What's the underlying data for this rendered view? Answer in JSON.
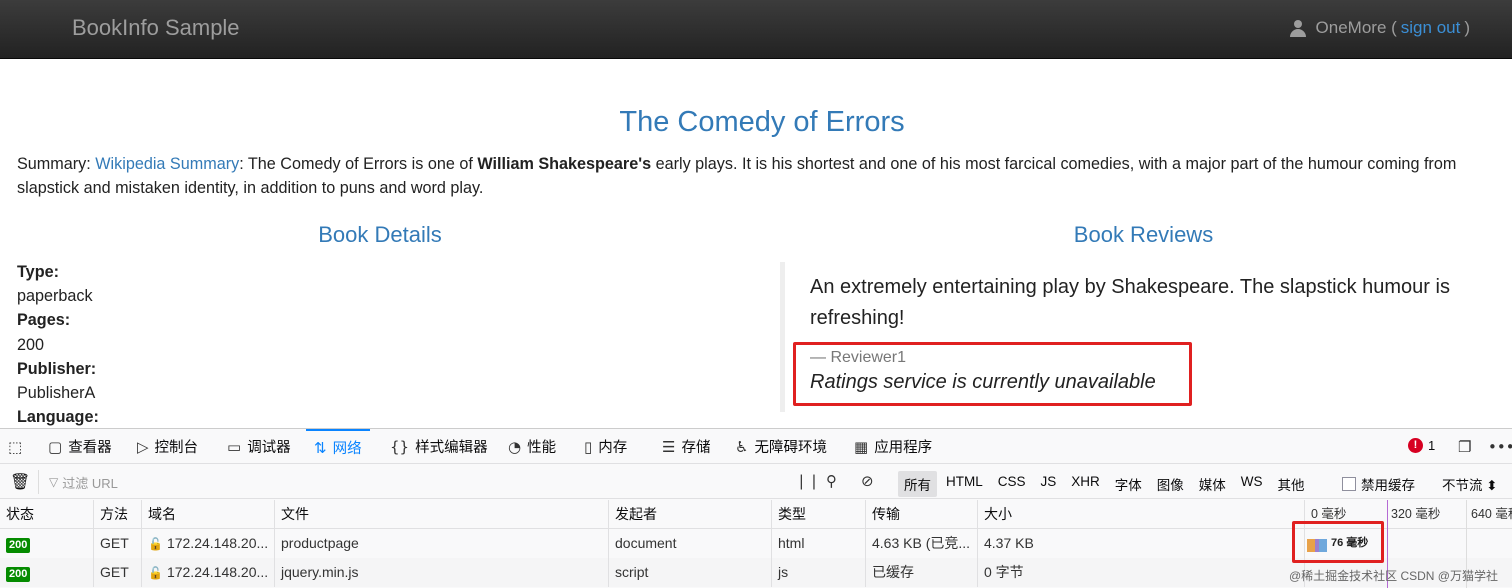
{
  "navbar": {
    "brand": "BookInfo Sample",
    "user_name": "OneMore (",
    "sign_out": "sign out",
    "close_paren": ")"
  },
  "book": {
    "title": "The Comedy of Errors",
    "summary_label": "Summary:",
    "summary_link": "Wikipedia Summary",
    "summary_pre": ": The Comedy of Errors is one of",
    "summary_bold": "William Shakespeare's",
    "summary_post": "early plays. It is his shortest and one of his most farcical comedies, with a major part of the humour coming from slapstick and mistaken identity, in addition to puns and word play."
  },
  "details": {
    "heading": "Book Details",
    "type_label": "Type:",
    "type_value": "paperback",
    "pages_label": "Pages:",
    "pages_value": "200",
    "publisher_label": "Publisher:",
    "publisher_value": "PublisherA",
    "language_label": "Language:"
  },
  "reviews": {
    "heading": "Book Reviews",
    "text": "An extremely entertaining play by Shakespeare. The slapstick humour is refreshing!",
    "reviewer": "— Reviewer1",
    "rating_status": "Ratings service is currently unavailable"
  },
  "devtools": {
    "tabs": [
      {
        "label": "查看器",
        "icon": "inspector-icon"
      },
      {
        "label": "控制台",
        "icon": "console-icon"
      },
      {
        "label": "调试器",
        "icon": "debugger-icon"
      },
      {
        "label": "网络",
        "icon": "network-icon",
        "active": true
      },
      {
        "label": "样式编辑器",
        "icon": "style-editor-icon"
      },
      {
        "label": "性能",
        "icon": "performance-icon"
      },
      {
        "label": "内存",
        "icon": "memory-icon"
      },
      {
        "label": "存储",
        "icon": "storage-icon"
      },
      {
        "label": "无障碍环境",
        "icon": "accessibility-icon"
      },
      {
        "label": "应用程序",
        "icon": "application-icon"
      }
    ],
    "error_count": "1",
    "filter_placeholder": "过滤 URL",
    "type_filters": [
      "所有",
      "HTML",
      "CSS",
      "JS",
      "XHR",
      "字体",
      "图像",
      "媒体",
      "WS",
      "其他"
    ],
    "disable_cache": "禁用缓存",
    "throttle": "不节流 ⬍",
    "columns": [
      "状态",
      "方法",
      "域名",
      "文件",
      "发起者",
      "类型",
      "传输",
      "大小"
    ],
    "timeline_ticks": [
      "0 毫秒",
      "320 毫秒",
      "640 毫秒"
    ],
    "rows": [
      {
        "status": "200",
        "method": "GET",
        "domain": "172.24.148.20...",
        "file": "productpage",
        "initiator": "document",
        "type": "html",
        "transferred": "4.63 KB (已竞...",
        "size": "4.37 KB",
        "timing": "76 毫秒"
      },
      {
        "status": "200",
        "method": "GET",
        "domain": "172.24.148.20...",
        "file": "jquery.min.js",
        "initiator": "script",
        "type": "js",
        "transferred": "已缓存",
        "size": "0 字节",
        "timing": ""
      }
    ],
    "watermark": "@稀土掘金技术社区  CSDN @万猫学社"
  },
  "colors": {
    "link": "#337ab7",
    "accent": "#0a84ff",
    "highlight": "#e02020",
    "status_ok": "#058b00"
  }
}
